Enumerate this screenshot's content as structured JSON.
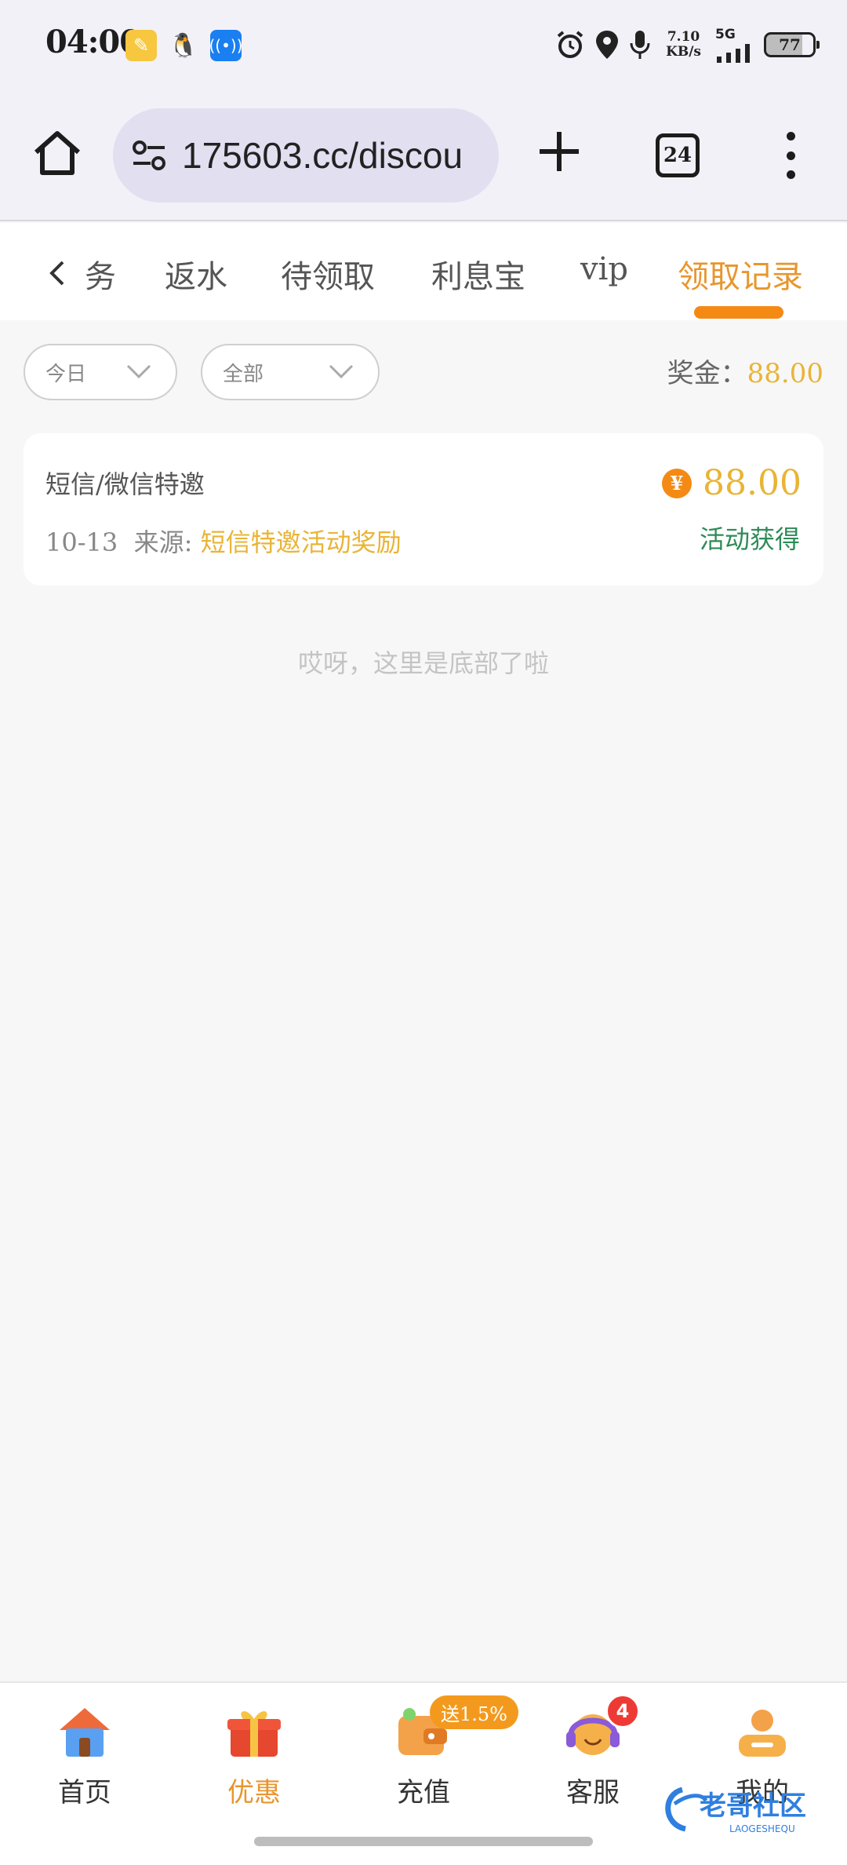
{
  "status_bar": {
    "time": "04:00",
    "net_speed_value": "7.10",
    "net_speed_unit": "KB/s",
    "network": "5G",
    "battery": "77"
  },
  "browser": {
    "url": "175603.cc/discou",
    "tab_count": "24"
  },
  "tabs": [
    {
      "label": "务",
      "active": false
    },
    {
      "label": "返水",
      "active": false
    },
    {
      "label": "待领取",
      "active": false
    },
    {
      "label": "利息宝",
      "active": false
    },
    {
      "label": "vip",
      "active": false
    },
    {
      "label": "领取记录",
      "active": true
    }
  ],
  "filters": {
    "date": "今日",
    "type": "全部",
    "bonus_label": "奖金：",
    "bonus_amount": "88.00"
  },
  "records": [
    {
      "title": "短信/微信特邀",
      "date": "10-13",
      "source_label": "来源:",
      "source": "短信特邀活动奖励",
      "amount": "88.00",
      "status": "活动获得"
    }
  ],
  "end_message": "哎呀，这里是底部了啦",
  "bottom_nav": [
    {
      "label": "首页",
      "icon": "home-icon",
      "active": false
    },
    {
      "label": "优惠",
      "icon": "gift-icon",
      "active": true
    },
    {
      "label": "充值",
      "icon": "wallet-icon",
      "active": false,
      "badge": "送1.5%"
    },
    {
      "label": "客服",
      "icon": "support-icon",
      "active": false,
      "badge": "4"
    },
    {
      "label": "我的",
      "icon": "profile-icon",
      "active": false
    }
  ],
  "watermark": "老哥社区",
  "watermark_sub": "LAOGESHEQU",
  "colors": {
    "accent": "#e8962e",
    "gold": "#e9b436",
    "green": "#2e8b57",
    "badge_red": "#ee3a34"
  }
}
